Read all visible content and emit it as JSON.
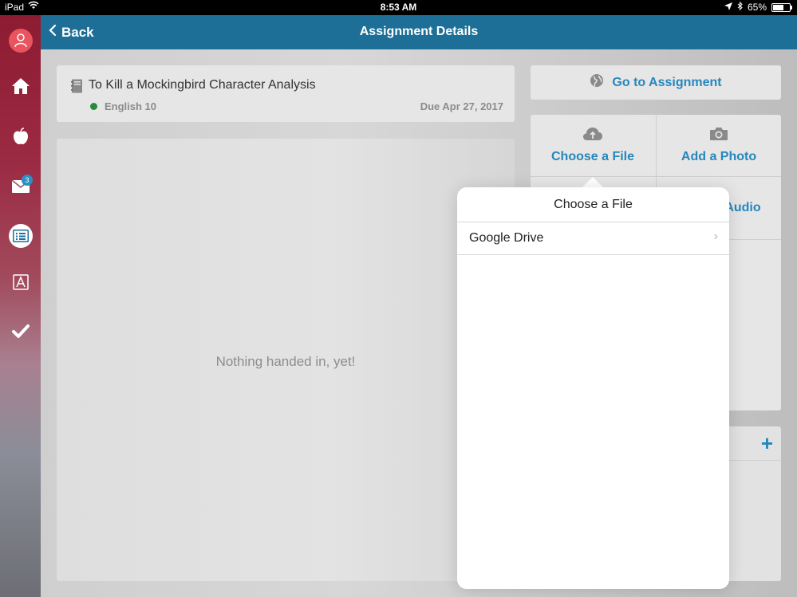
{
  "status_bar": {
    "device": "iPad",
    "time": "8:53 AM",
    "battery": "65%",
    "battery_level": 0.65
  },
  "sidebar": {
    "items": [
      {
        "name": "profile",
        "icon": "user-icon"
      },
      {
        "name": "home",
        "icon": "home-icon"
      },
      {
        "name": "classes",
        "icon": "apple-icon"
      },
      {
        "name": "messages",
        "icon": "mail-icon",
        "badge": "3"
      },
      {
        "name": "assignments",
        "icon": "list-icon",
        "active": true
      },
      {
        "name": "grades",
        "icon": "grade-icon"
      },
      {
        "name": "tasks",
        "icon": "check-icon"
      }
    ]
  },
  "header": {
    "back_label": "Back",
    "title": "Assignment Details",
    "color": "#1d6f97"
  },
  "assignment": {
    "title": "To Kill a Mockingbird Character Analysis",
    "class_name": "English 10",
    "class_color": "#2a8a3c",
    "due": "Due Apr 27, 2017"
  },
  "submission": {
    "empty_text": "Nothing handed in, yet!"
  },
  "actions": {
    "goto_label": "Go to Assignment",
    "choose_file_label": "Choose a File",
    "add_photo_label": "Add a Photo",
    "audio_partial_label": "Audio",
    "accent": "#2587bd"
  },
  "comments": {
    "add_symbol": "+"
  },
  "popover": {
    "title": "Choose a File",
    "items": [
      {
        "label": "Google Drive",
        "chevron": "›"
      }
    ]
  }
}
